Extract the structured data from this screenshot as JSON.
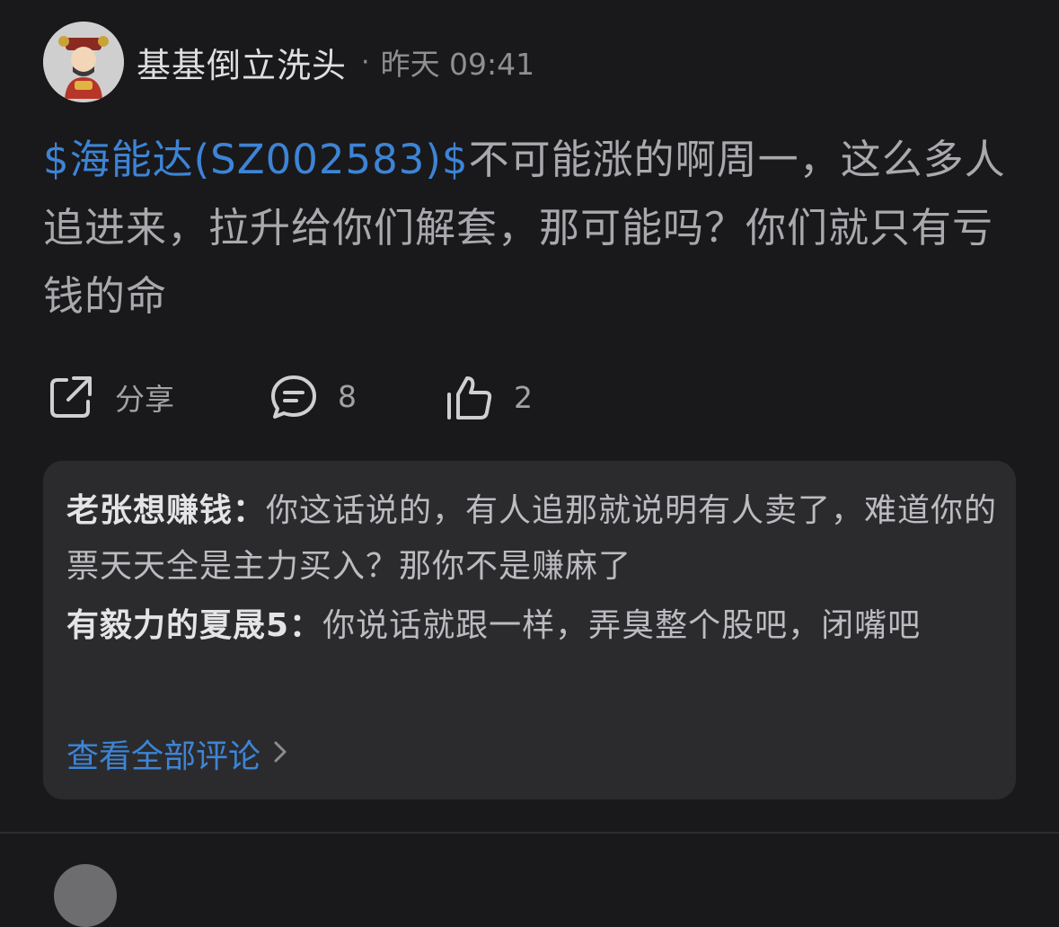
{
  "post": {
    "author": "基基倒立洗头",
    "separator": "·",
    "time": "昨天 09:41",
    "stock_link": "$海能达(SZ002583)$",
    "body": "不可能涨的啊周一，这么多人追进来，拉升给你们解套，那可能吗？你们就只有亏钱的命",
    "actions": {
      "share_label": "分享",
      "comment_count": "8",
      "like_count": "2"
    }
  },
  "comments": [
    {
      "name": "老张想赚钱：",
      "text": "你这话说的，有人追那就说明有人卖了，难道你的票天天全是主力买入？那你不是赚麻了"
    },
    {
      "name": "有毅力的夏晟5：",
      "text": "你说话就跟一样，弄臭整个股吧，闭嘴吧"
    }
  ],
  "view_all_label": "查看全部评论",
  "colors": {
    "background": "#19191b",
    "link": "#3d84d6",
    "card": "#2b2b2e"
  },
  "icons": [
    "share-icon",
    "comment-icon",
    "thumbs-up-icon",
    "chevron-right-icon",
    "avatar"
  ]
}
